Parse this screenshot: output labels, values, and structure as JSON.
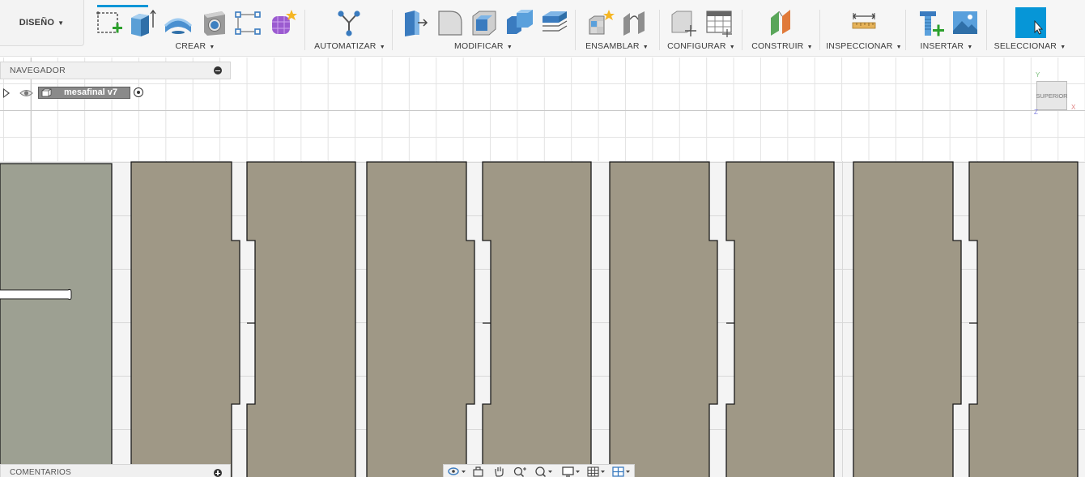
{
  "toolbar": {
    "workspace_label": "DISEÑO",
    "groups": [
      {
        "label": "CREAR",
        "icons": [
          "sketch-icon",
          "extrude-icon",
          "revolve-icon",
          "hole-icon",
          "pattern-icon",
          "form-icon"
        ]
      },
      {
        "label": "AUTOMATIZAR",
        "icons": [
          "automate-icon"
        ]
      },
      {
        "label": "MODIFICAR",
        "icons": [
          "press-pull-icon",
          "fillet-icon",
          "shell-icon",
          "combine-icon",
          "offset-face-icon"
        ]
      },
      {
        "label": "ENSAMBLAR",
        "icons": [
          "new-component-icon",
          "joint-icon"
        ]
      },
      {
        "label": "CONFIGURAR",
        "icons": [
          "parameters-icon",
          "configure-table-icon"
        ]
      },
      {
        "label": "CONSTRUIR",
        "icons": [
          "construct-plane-icon"
        ]
      },
      {
        "label": "INSPECCIONAR",
        "icons": [
          "measure-icon"
        ]
      },
      {
        "label": "INSERTAR",
        "icons": [
          "insert-mcmaster-icon",
          "insert-image-icon"
        ]
      },
      {
        "label": "SELECCIONAR",
        "icons": [
          "select-icon"
        ]
      }
    ],
    "accent_color": "#0696d7"
  },
  "navigator": {
    "title": "NAVEGADOR",
    "document_name": "mesafinal v7"
  },
  "viewcube": {
    "face_label": "SUPERIOR",
    "axis_y": "Y",
    "axis_x": "X",
    "axis_z": "Z"
  },
  "comments": {
    "title": "COMENTARIOS"
  },
  "navbar": {
    "tools": [
      "orbit-icon",
      "look-at-icon",
      "pan-icon",
      "zoom-icon",
      "fit-icon",
      "display-settings-icon",
      "grid-icon",
      "viewports-icon"
    ]
  },
  "colors": {
    "panel_fill": "#9f9886",
    "panel_left_fill": "#9da092",
    "panel_outline": "#1a1a1a"
  }
}
